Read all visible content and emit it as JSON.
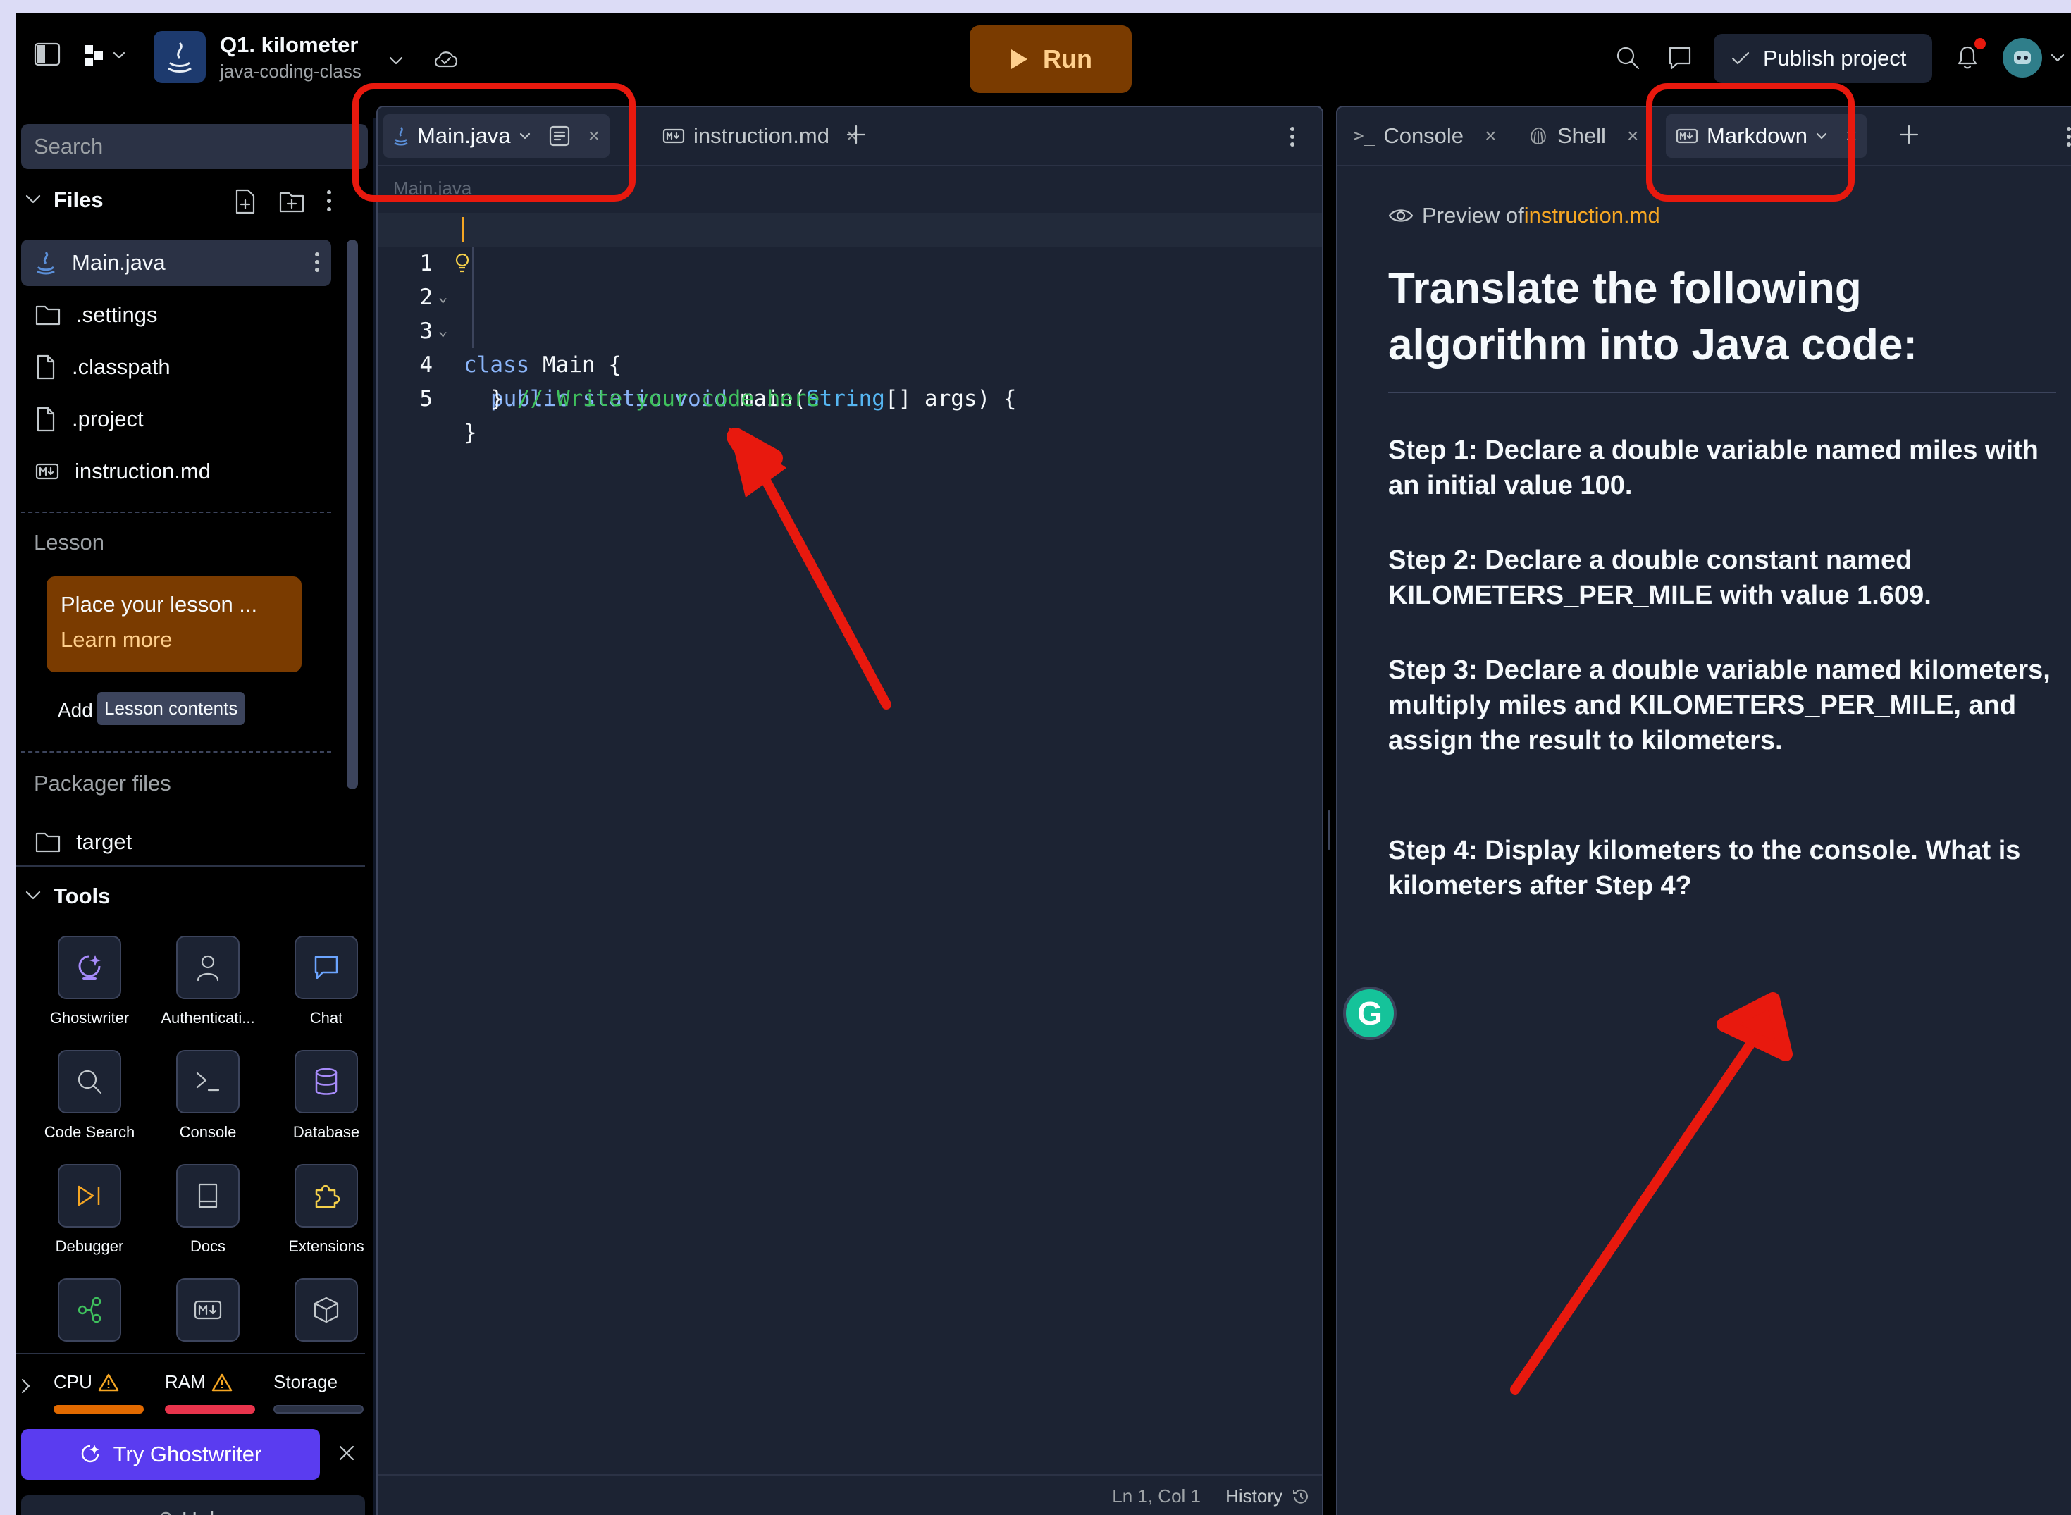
{
  "topbar": {
    "project_name": "Q1. kilometer",
    "project_sub": "java-coding-class",
    "run_label": "Run",
    "publish_label": "Publish project"
  },
  "sidebar": {
    "search_placeholder": "Search",
    "files_title": "Files",
    "files": [
      {
        "name": "Main.java",
        "icon": "java-icon"
      },
      {
        "name": ".settings",
        "icon": "folder-icon"
      },
      {
        "name": ".classpath",
        "icon": "file-icon"
      },
      {
        "name": ".project",
        "icon": "file-icon"
      },
      {
        "name": "instruction.md",
        "icon": "markdown-icon"
      }
    ],
    "lesson_title": "Lesson",
    "lesson_card_text": "Place your lesson ...",
    "lesson_card_link": "Learn more",
    "lesson_add": "Add",
    "lesson_tooltip": "Lesson contents",
    "packager_title": "Packager files",
    "packager_folder": "target",
    "tools_title": "Tools",
    "tools": [
      {
        "label": "Ghostwriter",
        "icon": "ghostwriter-icon"
      },
      {
        "label": "Authenticati...",
        "icon": "user-icon"
      },
      {
        "label": "Chat",
        "icon": "chat-icon"
      },
      {
        "label": "Code Search",
        "icon": "search-icon"
      },
      {
        "label": "Console",
        "icon": "terminal-icon"
      },
      {
        "label": "Database",
        "icon": "database-icon"
      },
      {
        "label": "Debugger",
        "icon": "debugger-icon"
      },
      {
        "label": "Docs",
        "icon": "book-icon"
      },
      {
        "label": "Extensions",
        "icon": "puzzle-icon"
      }
    ],
    "resources": {
      "cpu": "CPU",
      "ram": "RAM",
      "storage": "Storage"
    },
    "resource_levels": {
      "cpu": 1.0,
      "ram": 1.0,
      "storage": 0.0
    },
    "try_ghostwriter": "Try Ghostwriter",
    "help": "Help"
  },
  "editor": {
    "tabs": [
      {
        "label": "Main.java",
        "active": true
      },
      {
        "label": "instruction.md",
        "active": false
      }
    ],
    "breadcrumb": "Main.java",
    "line_numbers": [
      "1",
      "2",
      "3",
      "4",
      "5"
    ],
    "code": {
      "l1_kw": "class",
      "l1_rest": " Main {",
      "l2_kw": "public static void",
      "l2_mid": " main(",
      "l2_ty": "String",
      "l2_rest": "[] args) {",
      "l3": "// Write your code here",
      "l4": "}",
      "l5": "}"
    },
    "status_pos": "Ln 1, Col 1",
    "status_history": "History"
  },
  "right": {
    "tabs": [
      {
        "label": "Console",
        "active": false
      },
      {
        "label": "Shell",
        "active": false
      },
      {
        "label": "Markdown",
        "active": true
      }
    ],
    "preview_prefix": "Preview of ",
    "preview_file": "instruction.md",
    "heading": "Translate the following algorithm into Java code:",
    "steps": [
      "Step 1: Declare a double variable named miles with an initial value 100.",
      "Step 2: Declare a double constant named KILOMETERS_PER_MILE with value 1.609.",
      "Step 3: Declare a double variable named kilometers, multiply miles and KILOMETERS_PER_MILE, and assign the result to kilometers.",
      "Step 4: Display kilometers to the console. What is kilometers after Step 4?"
    ]
  },
  "colors": {
    "background": "#0e1525",
    "panel": "#1c2333",
    "run_button": "#7a3b00",
    "lesson_card": "#7a3b00",
    "ghostwriter_button": "#5a3cf0",
    "accent_link": "#f5a623",
    "annotation_red": "#e8190e"
  }
}
